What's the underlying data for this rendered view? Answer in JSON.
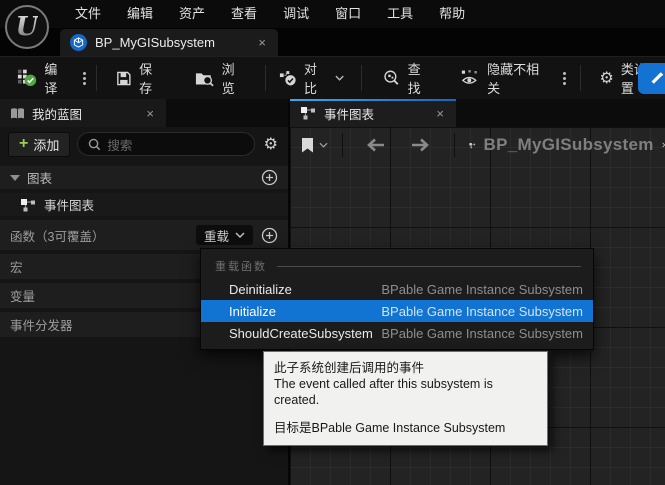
{
  "menu_bar": {
    "items": [
      "文件",
      "编辑",
      "资产",
      "查看",
      "调试",
      "窗口",
      "工具",
      "帮助"
    ]
  },
  "asset_tab": {
    "title": "BP_MyGISubsystem"
  },
  "icons": {
    "close": "×",
    "gear": "⚙",
    "plus": "+",
    "breadcrumb_chevron": "❯"
  },
  "toolbar": {
    "compile_label": "编译",
    "save_label": "保存",
    "browse_label": "浏览",
    "diff_label": "对比",
    "find_label": "查找",
    "hide_unrelated_label": "隐藏不相关",
    "class_settings_label": "类设置"
  },
  "my_blueprint_panel": {
    "tab_title": "我的蓝图",
    "add_button_label": "添加",
    "search_placeholder": "搜索",
    "graphs_label": "图表",
    "event_graph_label": "事件图表",
    "functions_label": "函数（3可覆盖）",
    "override_button_label": "重载",
    "macros_label": "宏",
    "variables_label": "变量",
    "dispatchers_label": "事件分发器"
  },
  "graph_panel": {
    "tab_title": "事件图表",
    "breadcrumb": "BP_MyGISubsystem"
  },
  "override_menu": {
    "header": "重载函数",
    "items": [
      {
        "name": "Deinitialize",
        "source": "BPable Game Instance Subsystem"
      },
      {
        "name": "Initialize",
        "source": "BPable Game Instance Subsystem"
      },
      {
        "name": "ShouldCreateSubsystem",
        "source": "BPable Game Instance Subsystem"
      }
    ],
    "selected_item": "Initialize"
  },
  "tooltip": {
    "line1": "此子系统创建后调用的事件",
    "line2": "The event called after this subsystem is created.",
    "line3": "目标是BPable Game Instance Subsystem"
  },
  "colors": {
    "selection_blue": "#1173d2",
    "tab_accent_blue": "#3ea7f0",
    "compile_check_green": "#4fa83d",
    "add_plus_green": "#9ccf4f",
    "asset_icon_blue": "#1568c6",
    "graph_background": "#232323",
    "tooltip_background": "#f1f1ef"
  }
}
